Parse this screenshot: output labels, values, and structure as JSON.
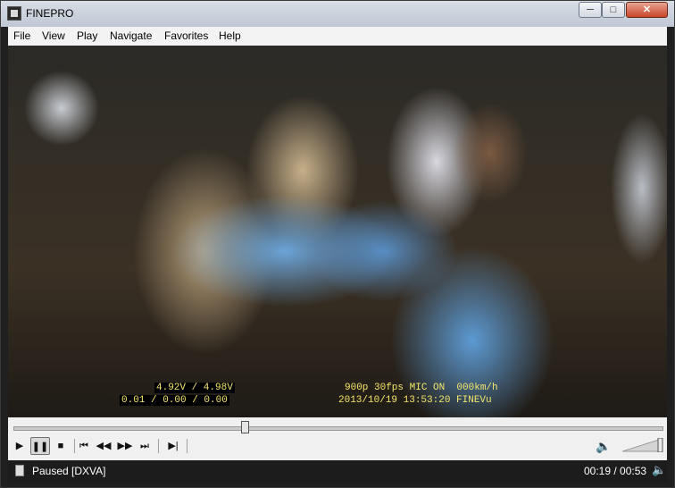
{
  "window": {
    "title": "FINEPRO",
    "controls": {
      "minimize": "─",
      "maximize": "□",
      "close": "✕"
    }
  },
  "menu": [
    "File",
    "View",
    "Play",
    "Navigate",
    "Favorites",
    "Help"
  ],
  "video_osd": {
    "voltage": "4.92V / 4.98V",
    "gsensor": "0.01 / 0.00 / 0.00",
    "info": "900p 30fps MIC ON  000km/h",
    "datetime": "2013/10/19 13:53:20 FINEVu"
  },
  "player": {
    "position_fraction": 0.358,
    "volume_fraction": 1.0,
    "buttons": {
      "play": "▶",
      "pause": "❚❚",
      "stop": "■",
      "prev": "⏮",
      "rewind": "◀◀",
      "forward": "▶▶",
      "next": "⏭",
      "frame_step": "▶|"
    },
    "speaker_icon": "speaker-icon"
  },
  "status": {
    "text": "Paused [DXVA]",
    "time": "00:19 / 00:53",
    "speaker_icon": "speaker-icon"
  },
  "colors": {
    "osd_text": "#f3e66a",
    "status_bg": "#1c1c1c"
  }
}
